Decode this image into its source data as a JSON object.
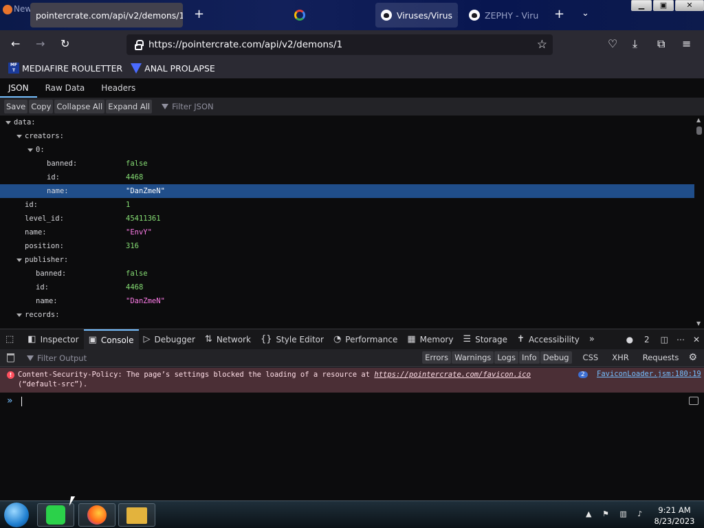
{
  "browser": {
    "ghost_tab_label": "New T",
    "active_tab": {
      "title": "pointercrate.com/api/v2/demons/1"
    },
    "tab_gh1": {
      "title": "Viruses/Virus"
    },
    "tab_gh2": {
      "title": "ZEPHY - Viru"
    },
    "url": "https://pointercrate.com/api/v2/demons/1",
    "bookmarks": [
      {
        "label": "MEDIAFIRE ROULETTER",
        "icon": "mediafire-icon"
      },
      {
        "label": "ANAL PROLAPSE",
        "icon": "triangle-icon"
      }
    ]
  },
  "json_viewer": {
    "tabs": [
      "JSON",
      "Raw Data",
      "Headers"
    ],
    "active_tab": "JSON",
    "toolbar": {
      "save": "Save",
      "copy": "Copy",
      "collapse": "Collapse All",
      "expand": "Expand All",
      "filter_placeholder": "Filter JSON"
    },
    "rows": [
      {
        "key": "data:",
        "value": "",
        "type": "obj",
        "expanded": true
      },
      {
        "key": "creators:",
        "value": "",
        "type": "obj",
        "expanded": true
      },
      {
        "key": "0:",
        "value": "",
        "type": "obj",
        "expanded": true
      },
      {
        "key": "banned:",
        "value": "false",
        "type": "bool"
      },
      {
        "key": "id:",
        "value": "4468",
        "type": "num"
      },
      {
        "key": "name:",
        "value": "\"DanZmeN\"",
        "type": "str",
        "selected": true
      },
      {
        "key": "id:",
        "value": "1",
        "type": "num"
      },
      {
        "key": "level_id:",
        "value": "45411361",
        "type": "num"
      },
      {
        "key": "name:",
        "value": "\"EnvY\"",
        "type": "str"
      },
      {
        "key": "position:",
        "value": "316",
        "type": "num"
      },
      {
        "key": "publisher:",
        "value": "",
        "type": "obj",
        "expanded": true
      },
      {
        "key": "banned:",
        "value": "false",
        "type": "bool"
      },
      {
        "key": "id:",
        "value": "4468",
        "type": "num"
      },
      {
        "key": "name:",
        "value": "\"DanZmeN\"",
        "type": "str"
      },
      {
        "key": "records:",
        "value": "",
        "type": "obj",
        "expanded": true
      }
    ]
  },
  "devtools": {
    "tabs": [
      {
        "label": "Inspector",
        "icon": "inspector-icon"
      },
      {
        "label": "Console",
        "icon": "console-icon",
        "active": true
      },
      {
        "label": "Debugger",
        "icon": "debugger-icon"
      },
      {
        "label": "Network",
        "icon": "network-icon"
      },
      {
        "label": "Style Editor",
        "icon": "style-editor-icon"
      },
      {
        "label": "Performance",
        "icon": "performance-icon"
      },
      {
        "label": "Memory",
        "icon": "memory-icon"
      },
      {
        "label": "Storage",
        "icon": "storage-icon"
      },
      {
        "label": "Accessibility",
        "icon": "accessibility-icon"
      }
    ],
    "error_count": "2",
    "console": {
      "filter_placeholder": "Filter Output",
      "levels": [
        "Errors",
        "Warnings",
        "Logs",
        "Info",
        "Debug"
      ],
      "types": [
        "CSS",
        "XHR",
        "Requests"
      ],
      "message": {
        "prefix": "Content-Security-Policy: The page’s settings blocked the loading of a resource at ",
        "link": "https://pointercrate.com/favicon.ico",
        "suffix": " (“default-src”).",
        "repeat_count": "2",
        "source": "FaviconLoader.jsm:180:19"
      }
    }
  },
  "taskbar": {
    "time": "9:21 AM",
    "date": "8/23/2023"
  }
}
